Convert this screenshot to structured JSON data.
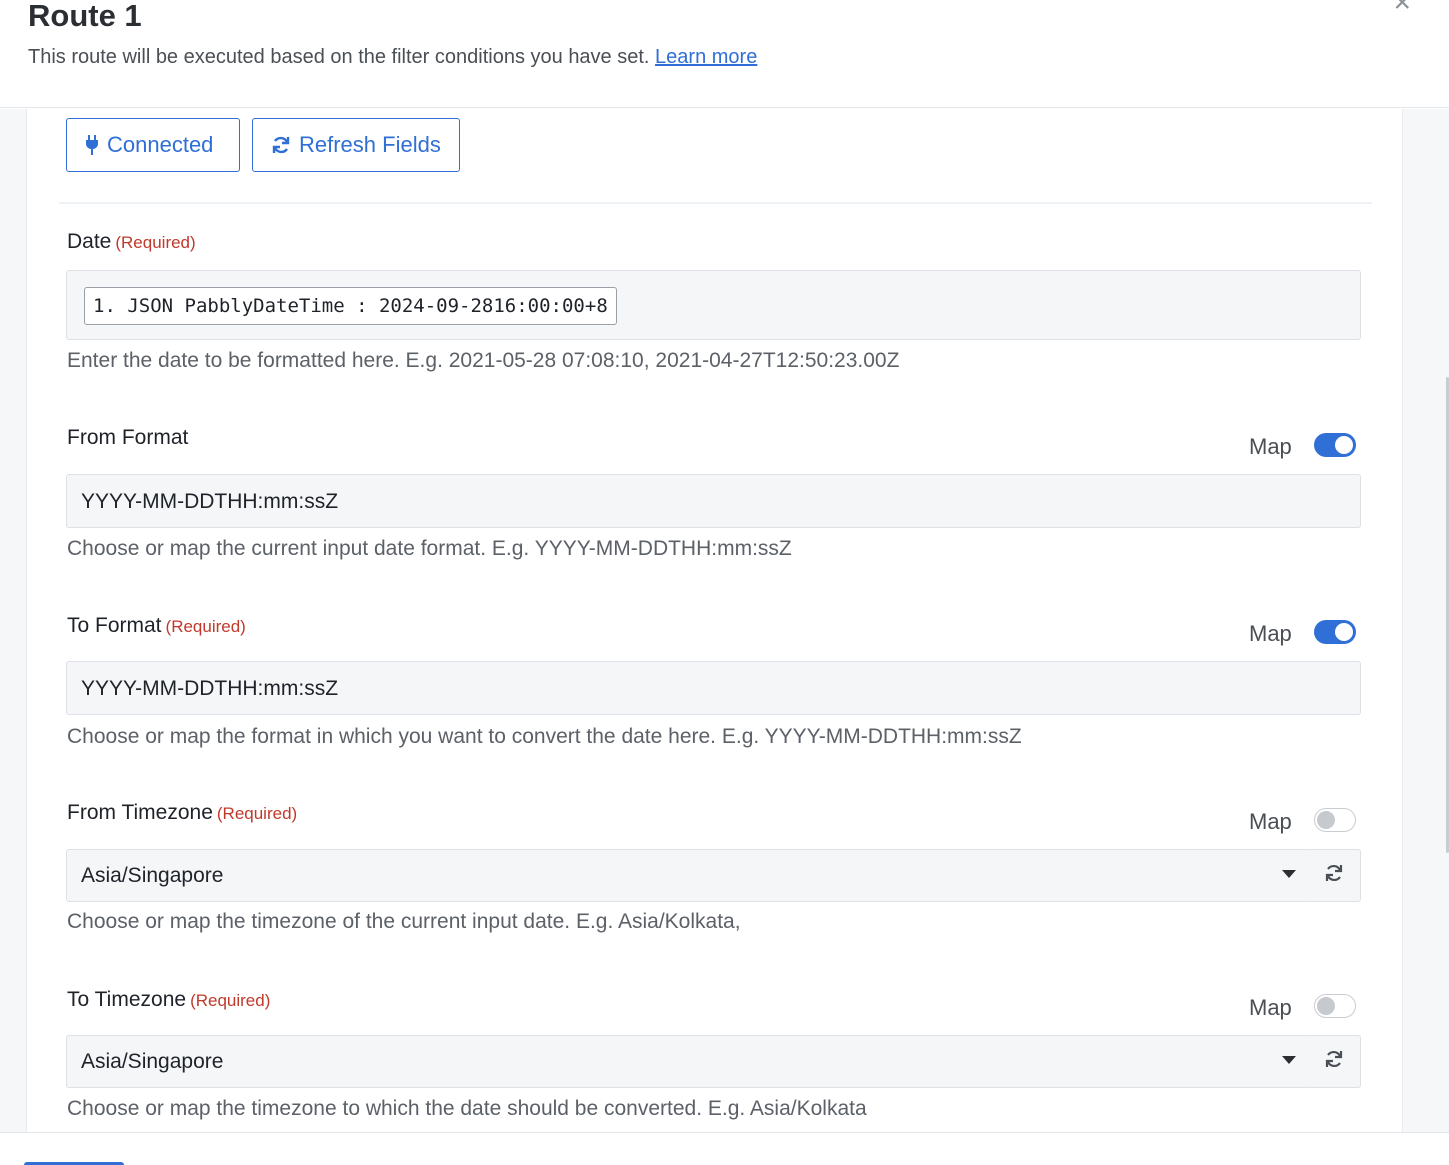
{
  "header": {
    "title": "Route 1",
    "subtitle": "This route will be executed based on the filter conditions you have set.",
    "learn_more": "Learn more",
    "close_symbol": "×"
  },
  "toolbar": {
    "connected_label": "Connected",
    "refresh_label": "Refresh Fields"
  },
  "fields": {
    "date": {
      "label": "Date",
      "required": "(Required)",
      "chip": "1. JSON PabblyDateTime : 2024-09-2816:00:00+8",
      "help": "Enter the date to be formatted here. E.g. 2021-05-28 07:08:10, 2021-04-27T12:50:23.00Z"
    },
    "from_format": {
      "label": "From Format",
      "map_label": "Map",
      "map_on": true,
      "value": "YYYY-MM-DDTHH:mm:ssZ",
      "help": "Choose or map the current input date format. E.g. YYYY-MM-DDTHH:mm:ssZ"
    },
    "to_format": {
      "label": "To Format",
      "required": "(Required)",
      "map_label": "Map",
      "map_on": true,
      "value": "YYYY-MM-DDTHH:mm:ssZ",
      "help": "Choose or map the format in which you want to convert the date here. E.g. YYYY-MM-DDTHH:mm:ssZ"
    },
    "from_timezone": {
      "label": "From Timezone",
      "required": "(Required)",
      "map_label": "Map",
      "map_on": false,
      "value": "Asia/Singapore",
      "help": "Choose or map the timezone of the current input date. E.g. Asia/Kolkata,"
    },
    "to_timezone": {
      "label": "To Timezone",
      "required": "(Required)",
      "map_label": "Map",
      "map_on": false,
      "value": "Asia/Singapore",
      "help": "Choose or map the timezone to which the date should be converted. E.g. Asia/Kolkata"
    }
  },
  "colors": {
    "accent": "#2f6fd6",
    "required": "#c0392b",
    "input_bg": "#f4f6f8"
  },
  "icons": {
    "connected": "plug-icon",
    "refresh": "refresh-icon",
    "close": "close-icon",
    "caret": "caret-down-icon"
  }
}
